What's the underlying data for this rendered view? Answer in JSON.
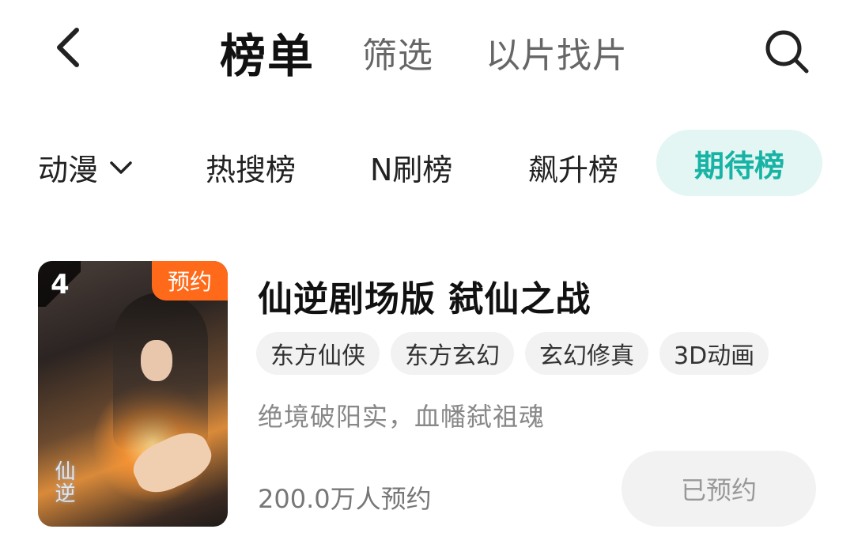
{
  "header": {
    "tabs": [
      {
        "label": "榜单",
        "active": true
      },
      {
        "label": "筛选",
        "active": false
      },
      {
        "label": "以片找片",
        "active": false
      }
    ],
    "back_icon": "chevron-left-icon",
    "search_icon": "search-icon"
  },
  "categories": {
    "dropdown_label": "动漫",
    "dropdown_icon": "chevron-down-icon",
    "items": [
      {
        "label": "热搜榜",
        "active": false
      },
      {
        "label": "N刷榜",
        "active": false
      },
      {
        "label": "飙升榜",
        "active": false
      },
      {
        "label": "期待榜",
        "active": true
      }
    ],
    "active_color": "#17b3a4",
    "active_bg": "#e3f6f3"
  },
  "item": {
    "rank": "4",
    "badge": "预约",
    "badge_color": "#ff6a1a",
    "poster_text": "仙逆",
    "title": "仙逆剧场版 弑仙之战",
    "tags": [
      "东方仙侠",
      "东方玄幻",
      "玄幻修真",
      "3D动画"
    ],
    "description": "绝境破阳实，血幡弑祖魂",
    "count": "200.0万人预约",
    "button_label": "已预约"
  }
}
